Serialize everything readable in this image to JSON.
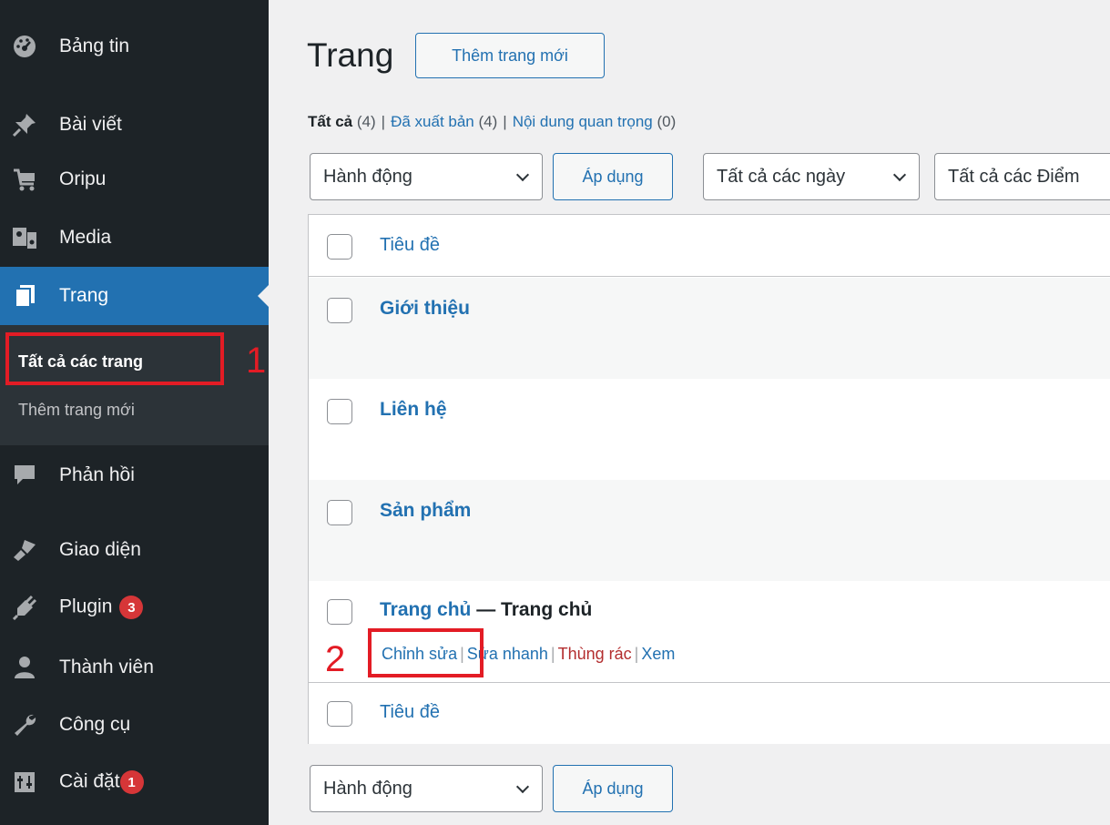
{
  "sidebar": {
    "items": [
      {
        "label": "Bảng tin",
        "icon": "dashboard-icon"
      },
      {
        "label": "Bài viết",
        "icon": "pin-icon"
      },
      {
        "label": "Oripu",
        "icon": "cart-icon"
      },
      {
        "label": "Media",
        "icon": "media-icon"
      },
      {
        "label": "Trang",
        "icon": "page-icon"
      },
      {
        "label": "Phản hồi",
        "icon": "comment-icon"
      },
      {
        "label": "Giao diện",
        "icon": "brush-icon"
      },
      {
        "label": "Plugin",
        "icon": "plugin-icon",
        "badge": "3"
      },
      {
        "label": "Thành viên",
        "icon": "user-icon"
      },
      {
        "label": "Công cụ",
        "icon": "wrench-icon"
      },
      {
        "label": "Cài đặt",
        "icon": "settings-icon",
        "badge": "1"
      }
    ],
    "submenu": [
      {
        "label": "Tất cả các trang",
        "current": true
      },
      {
        "label": "Thêm trang mới"
      }
    ]
  },
  "annotations": [
    "1",
    "2"
  ],
  "header": {
    "title": "Trang",
    "add_new_label": "Thêm trang mới"
  },
  "filters": {
    "all": "Tất cả",
    "all_count": "(4)",
    "published": "Đã xuất bản",
    "published_count": "(4)",
    "important": "Nội dung quan trọng",
    "important_count": "(0)",
    "separator": "|"
  },
  "toolbar": {
    "bulk_action": "Hành động",
    "apply": "Áp dụng",
    "dates": "Tất cả các ngày",
    "points": "Tất cả các Điểm"
  },
  "table": {
    "column_title": "Tiêu đề",
    "rows": [
      {
        "title": "Giới thiệu"
      },
      {
        "title": "Liên hệ"
      },
      {
        "title": "Sản phẩm"
      },
      {
        "title": "Trang chủ",
        "state": "— Trang chủ"
      }
    ],
    "row_actions": {
      "edit": "Chỉnh sửa",
      "quick_edit": "Sửa nhanh",
      "trash": "Thùng rác",
      "view": "Xem",
      "separator": "|"
    }
  },
  "colors": {
    "sidebar_bg": "#1d2327",
    "accent": "#2271b1",
    "annotation": "#e31c25",
    "badge": "#d63638"
  }
}
